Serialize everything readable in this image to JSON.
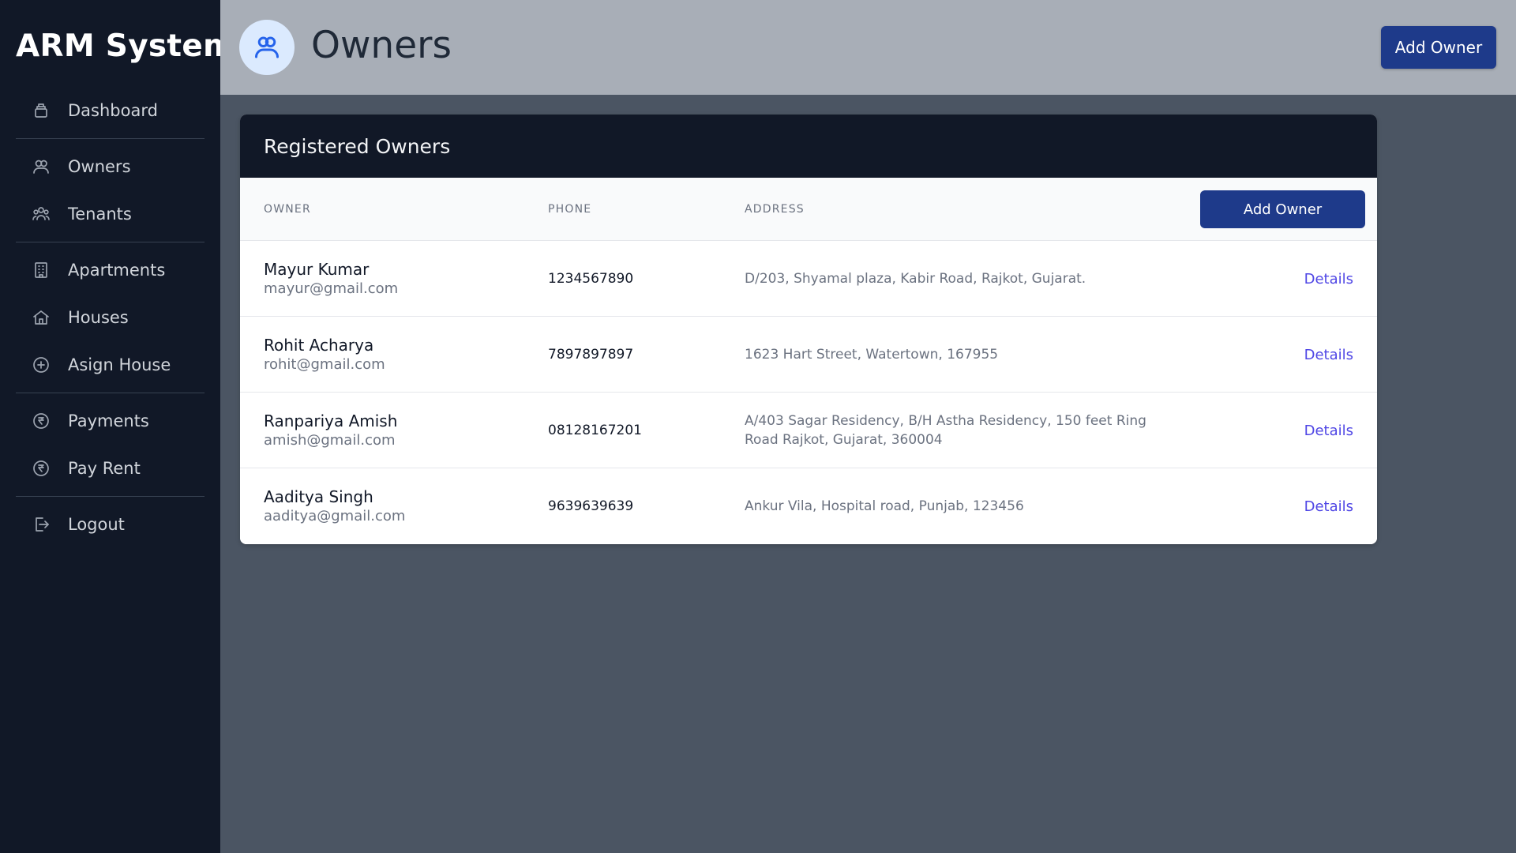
{
  "app": {
    "title": "ARM System"
  },
  "sidebar": {
    "items": [
      {
        "label": "Dashboard",
        "icon": "dashboard-icon"
      },
      {
        "label": "Owners",
        "icon": "users-icon"
      },
      {
        "label": "Tenants",
        "icon": "user-group-icon"
      },
      {
        "label": "Apartments",
        "icon": "building-icon"
      },
      {
        "label": "Houses",
        "icon": "home-icon"
      },
      {
        "label": "Asign House",
        "icon": "plus-circle-icon"
      },
      {
        "label": "Payments",
        "icon": "rupee-icon"
      },
      {
        "label": "Pay Rent",
        "icon": "rupee-icon"
      },
      {
        "label": "Logout",
        "icon": "logout-icon"
      }
    ]
  },
  "header": {
    "title": "Owners",
    "icon": "users-icon",
    "add_button": "Add Owner"
  },
  "table": {
    "title": "Registered Owners",
    "columns": [
      "Owner",
      "Phone",
      "Address"
    ],
    "add_button": "Add Owner",
    "action_label": "Details",
    "rows": [
      {
        "name": "Mayur Kumar",
        "email": "mayur@gmail.com",
        "phone": "1234567890",
        "address": "D/203, Shyamal plaza, Kabir Road, Rajkot, Gujarat."
      },
      {
        "name": "Rohit Acharya",
        "email": "rohit@gmail.com",
        "phone": "7897897897",
        "address": "1623 Hart Street, Watertown, 167955"
      },
      {
        "name": "Ranpariya Amish",
        "email": "amish@gmail.com",
        "phone": "08128167201",
        "address": "A/403 Sagar Residency, B/H Astha Residency, 150 feet Ring Road Rajkot, Gujarat, 360004"
      },
      {
        "name": "Aaditya Singh",
        "email": "aaditya@gmail.com",
        "phone": "9639639639",
        "address": "Ankur Vila, Hospital road, Punjab, 123456"
      }
    ]
  },
  "colors": {
    "sidebar_bg": "#111827",
    "topbar_bg": "#a8aeb7",
    "content_bg": "#4b5563",
    "primary_button": "#1e3a8a",
    "link": "#4f46e5"
  }
}
